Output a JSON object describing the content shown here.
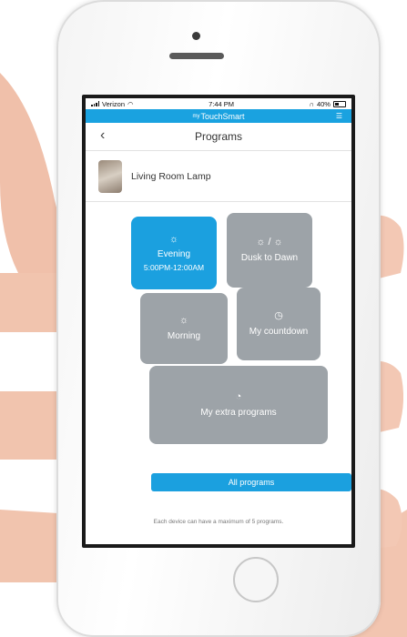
{
  "status_bar": {
    "carrier": "Verizon",
    "time": "7:44 PM",
    "battery": "40%"
  },
  "brand": {
    "prefix": "my",
    "name": "TouchSmart"
  },
  "header": {
    "title": "Programs"
  },
  "device": {
    "name": "Living Room Lamp"
  },
  "tiles": {
    "evening": {
      "label": "Evening",
      "time": "5:00PM-12:00AM",
      "icon": "sunset-icon"
    },
    "dusk": {
      "label": "Dusk to Dawn",
      "icon": "sunset-sunrise-icon",
      "icon_separator": "/"
    },
    "morning": {
      "label": "Morning",
      "icon": "sunrise-icon"
    },
    "countdown": {
      "label": "My countdown",
      "icon": "timer-icon"
    },
    "extra": {
      "label": "My extra programs",
      "icon": "clock-plus-icon"
    }
  },
  "all_programs_label": "All programs",
  "footnote": "Each device can have a maximum of 5 programs.",
  "colors": {
    "accent": "#1ba0df",
    "tile_inactive": "#9da3a8"
  }
}
